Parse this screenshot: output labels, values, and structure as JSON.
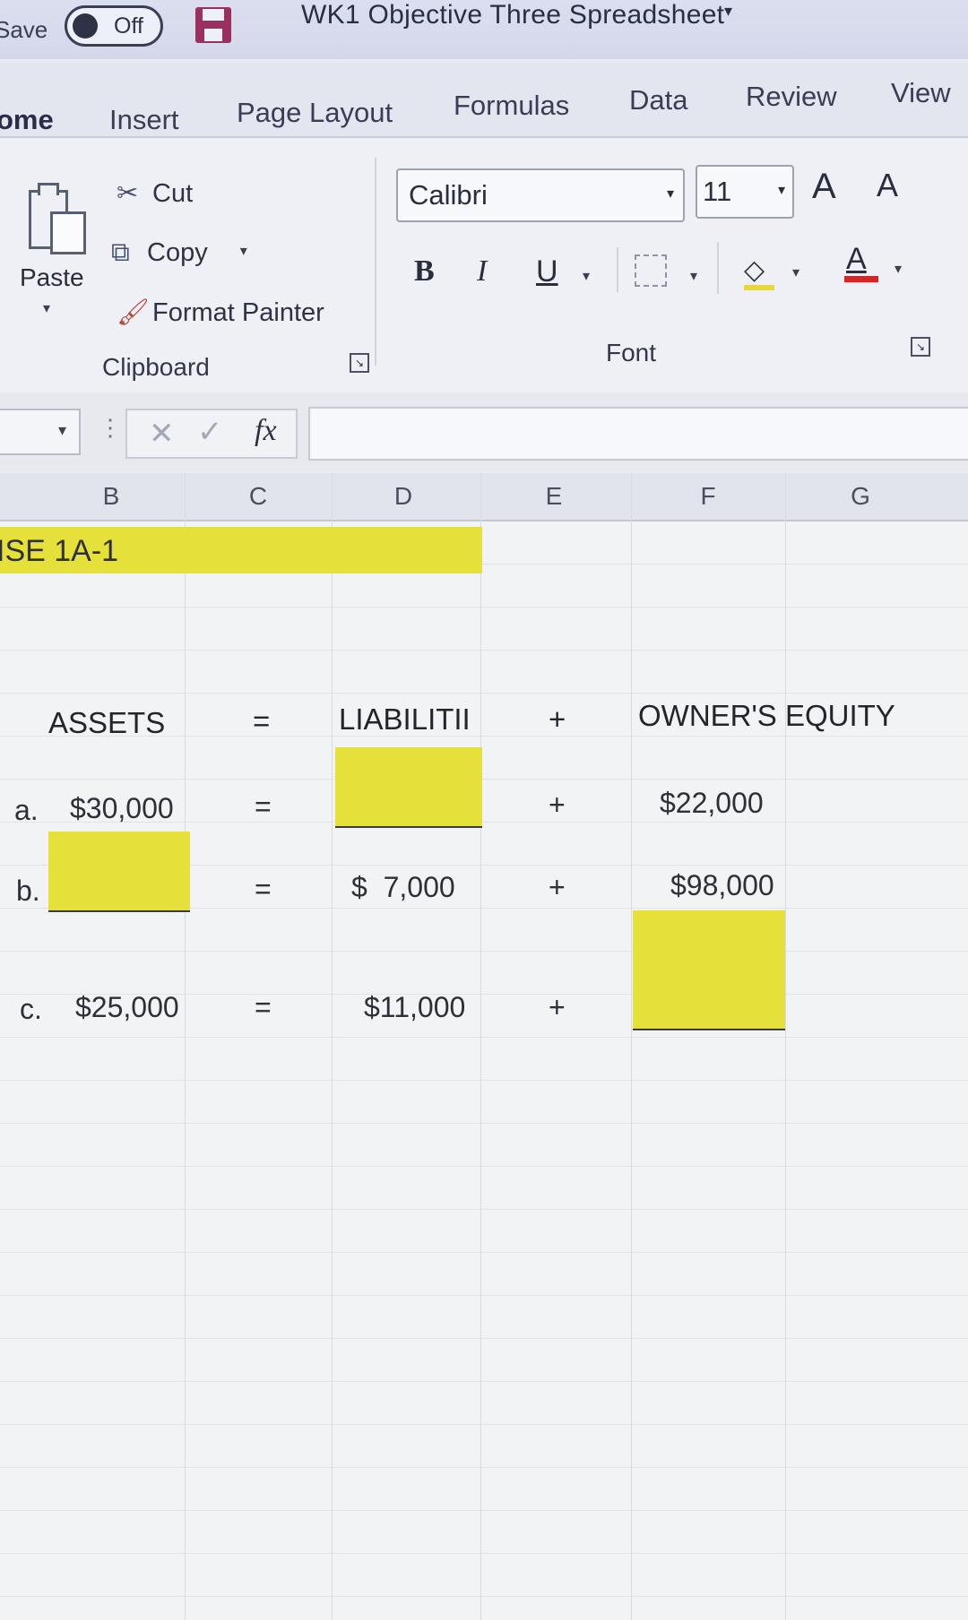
{
  "titlebar": {
    "autosave_label": "Save",
    "toggle_state": "Off",
    "doc_title": "WK1 Objective Three Spreadsheet"
  },
  "tabs": [
    "ome",
    "Insert",
    "Page Layout",
    "Formulas",
    "Data",
    "Review",
    "View"
  ],
  "clipboard": {
    "paste": "Paste",
    "cut": "Cut",
    "copy": "Copy",
    "format_painter": "Format Painter",
    "group_label": "Clipboard"
  },
  "font": {
    "family": "Calibri",
    "size": "11",
    "bold": "B",
    "italic": "I",
    "underline": "U",
    "grow": "A",
    "shrink": "A",
    "font_color": "A",
    "group_label": "Font"
  },
  "formula_bar": {
    "fx": "fx",
    "value": ""
  },
  "columns": [
    "B",
    "C",
    "D",
    "E",
    "F",
    "G"
  ],
  "sheet": {
    "exercise_title": "ISE 1A-1",
    "headers": {
      "assets": "ASSETS",
      "eq": "=",
      "liabilities": "LIABILITII",
      "plus": "+",
      "equity": "OWNER'S EQUITY"
    },
    "rows": [
      {
        "label": "a.",
        "assets": "$30,000",
        "eq": "=",
        "liabilities": "",
        "plus": "+",
        "equity": "$22,000"
      },
      {
        "label": "b.",
        "assets": "",
        "eq": "=",
        "liabilities": "$  7,000",
        "plus": "+",
        "equity": "$98,000"
      },
      {
        "label": "c.",
        "assets": "$25,000",
        "eq": "=",
        "liabilities": "$11,000",
        "plus": "+",
        "equity": ""
      }
    ]
  },
  "colors": {
    "highlight": "#e6e13a",
    "accent_disk": "#9b2f5f",
    "font_color_bar": "#d02828"
  }
}
